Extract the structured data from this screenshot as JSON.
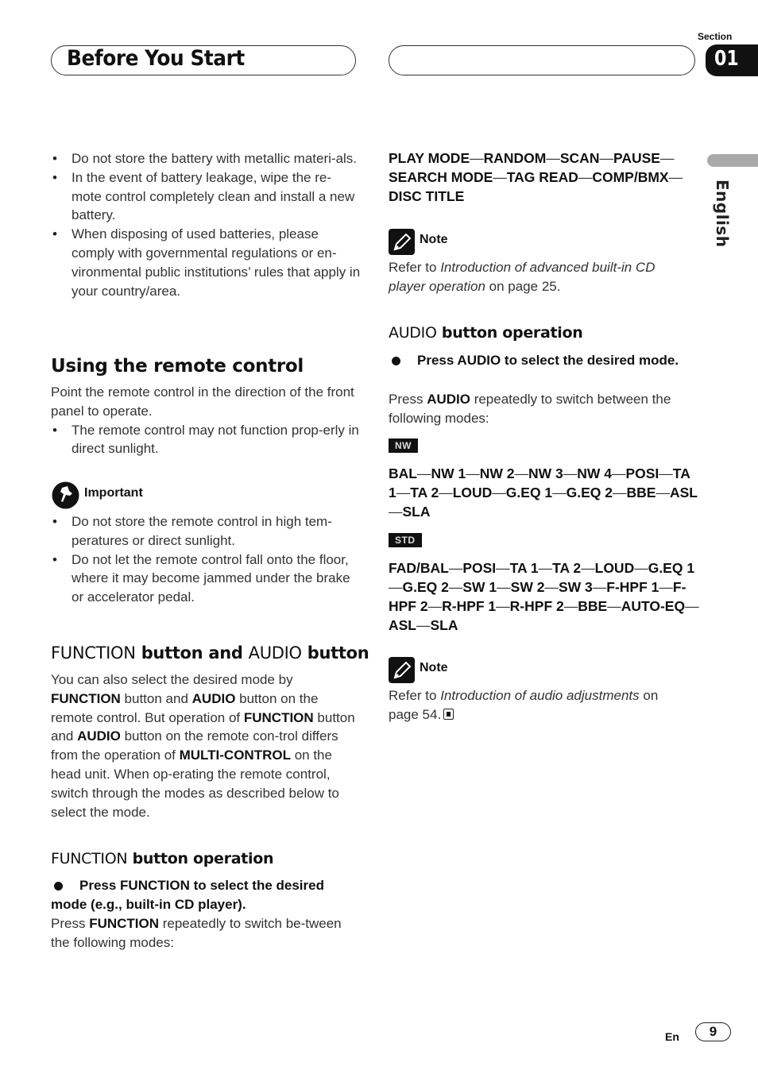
{
  "header": {
    "title": "Before You Start",
    "section_label": "Section",
    "section_number": "01",
    "language_tab": "English"
  },
  "left_column": {
    "battery_bullets": [
      "Do not store the battery with metallic materi-als.",
      "In the event of battery leakage, wipe the re-mote control completely clean and install a new battery.",
      "When disposing of used batteries, please comply with governmental regulations or en-vironmental public institutions’ rules that apply in your country/area."
    ],
    "remote_section": {
      "heading": "Using the remote control",
      "intro": "Point the remote control in the direction of the front panel to operate.",
      "bullets": [
        "The remote control may not function prop-erly in direct sunlight."
      ]
    },
    "important": {
      "label": "Important",
      "icon": "pushpin-icon",
      "bullets": [
        "Do not store the remote control in high tem-peratures or direct sunlight.",
        "Do not let the remote control fall onto the floor, where it may become jammed under the brake or accelerator pedal."
      ]
    },
    "function_audio_section": {
      "heading_part1": "FUNCTION",
      "heading_part2": " button and ",
      "heading_part3": "AUDIO",
      "heading_part4": " button",
      "paragraph": [
        {
          "t": "You can also select the desired mode by ",
          "b": false
        },
        {
          "t": "FUNCTION",
          "b": true
        },
        {
          "t": " button and ",
          "b": false
        },
        {
          "t": "AUDIO",
          "b": true
        },
        {
          "t": " button on the remote control. But operation of ",
          "b": false
        },
        {
          "t": "FUNCTION",
          "b": true
        },
        {
          "t": " button and ",
          "b": false
        },
        {
          "t": "AUDIO",
          "b": true
        },
        {
          "t": " button on the remote con-trol differs from the operation of ",
          "b": false
        },
        {
          "t": "MULTI-CONTROL",
          "b": true
        },
        {
          "t": " on the head unit. When op-erating the remote control, switch through the modes as described below to select the mode.",
          "b": false
        }
      ]
    },
    "function_operation": {
      "heading_part1": "FUNCTION",
      "heading_part2": " button operation",
      "step": "Press FUNCTION to select the desired mode (e.g., built-in CD player).",
      "desc_pre": "Press ",
      "desc_bold": "FUNCTION",
      "desc_post": " repeatedly to switch be-tween the following modes:"
    }
  },
  "right_column": {
    "function_modes": [
      "PLAY MODE",
      "RANDOM",
      "SCAN",
      "PAUSE",
      "SEARCH MODE",
      "TAG READ",
      "COMP/BMX",
      "DISC TITLE"
    ],
    "note1": {
      "label": "Note",
      "icon": "pencil-icon",
      "text_pre": "Refer to ",
      "text_italic": "Introduction of advanced built-in CD player operation",
      "text_post": " on page 25."
    },
    "audio_operation": {
      "heading_part1": "AUDIO",
      "heading_part2": " button operation",
      "step": "Press AUDIO to select the desired mode.",
      "desc_pre": "Press ",
      "desc_bold": "AUDIO",
      "desc_post": " repeatedly to switch between the following modes:"
    },
    "nw_badge": "NW",
    "nw_modes": [
      "BAL",
      "NW 1",
      "NW 2",
      "NW 3",
      "NW 4",
      "POSI",
      "TA 1",
      "TA 2",
      "LOUD",
      "G.EQ 1",
      "G.EQ 2",
      "BBE",
      "ASL",
      "SLA"
    ],
    "std_badge": "STD",
    "std_modes": [
      "FAD/BAL",
      "POSI",
      "TA 1",
      "TA 2",
      "LOUD",
      "G.EQ 1",
      "G.EQ 2",
      "SW 1",
      "SW 2",
      "SW 3",
      "F-HPF 1",
      "F-HPF 2",
      "R-HPF 1",
      "R-HPF 2",
      "BBE",
      "AUTO-EQ",
      "ASL",
      "SLA"
    ],
    "note2": {
      "label": "Note",
      "icon": "pencil-icon",
      "text_pre": "Refer to ",
      "text_italic": "Introduction of audio adjustments",
      "text_post": " on page 54.",
      "end_icon": "end-of-section-icon"
    }
  },
  "footer": {
    "language": "En",
    "page_number": "9"
  }
}
